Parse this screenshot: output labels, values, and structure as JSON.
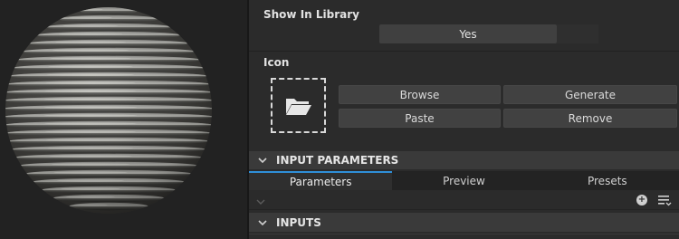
{
  "library": {
    "label": "Show In Library",
    "value": "Yes"
  },
  "icon": {
    "label": "Icon",
    "slot_icon": "folder-open-icon",
    "buttons": {
      "browse": "Browse",
      "generate": "Generate",
      "paste": "Paste",
      "remove": "Remove"
    }
  },
  "input_parameters": {
    "title": "INPUT PARAMETERS",
    "tabs": [
      {
        "label": "Parameters",
        "active": true
      },
      {
        "label": "Preview",
        "active": false
      },
      {
        "label": "Presets",
        "active": false
      }
    ]
  },
  "inputs": {
    "title": "INPUTS"
  },
  "colors": {
    "panel_bg": "#2b2b2b",
    "button_bg": "#414141",
    "tab_accent": "#2f8fd8"
  }
}
